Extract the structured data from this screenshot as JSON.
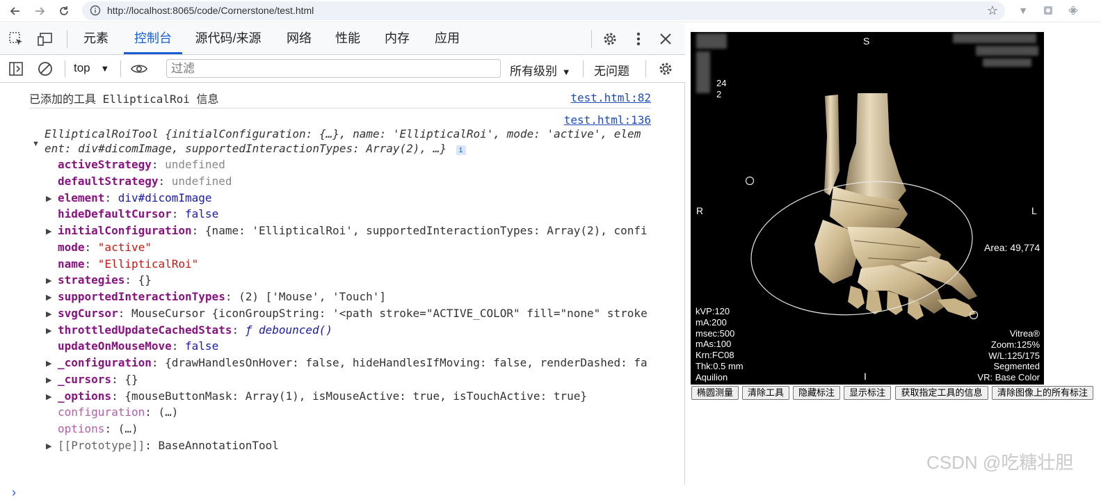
{
  "browser": {
    "url": "http://localhost:8065/code/Cornerstone/test.html"
  },
  "devtools": {
    "tabs": [
      "元素",
      "控制台",
      "源代码/来源",
      "网络",
      "性能",
      "内存",
      "应用"
    ],
    "active_tab": "控制台",
    "context": "top",
    "filter_placeholder": "过滤",
    "levels": "所有级别",
    "issues": "无问题"
  },
  "console": {
    "message1": {
      "text": "已添加的工具 EllipticalRoi 信息",
      "source": "test.html:82"
    },
    "message2": {
      "source": "test.html:136",
      "summary_line1": "EllipticalRoiTool {initialConfiguration: {…}, name: 'EllipticalRoi', mode: 'active', elem",
      "summary_line2": "ent: div#dicomImage, supportedInteractionTypes: Array(2), …}",
      "info_badge": "i",
      "props": [
        {
          "key": "activeStrategy",
          "value": "undefined"
        },
        {
          "key": "defaultStrategy",
          "value": "undefined"
        },
        {
          "key": "element",
          "value": "div#dicomImage"
        },
        {
          "key": "hideDefaultCursor",
          "value": "false"
        },
        {
          "key": "initialConfiguration",
          "value": "{name: 'EllipticalRoi', supportedInteractionTypes: Array(2), confi"
        },
        {
          "key": "mode",
          "value": "\"active\""
        },
        {
          "key": "name",
          "value": "\"EllipticalRoi\""
        },
        {
          "key": "strategies",
          "value": "{}"
        },
        {
          "key": "supportedInteractionTypes",
          "value": "(2) ['Mouse', 'Touch']"
        },
        {
          "key": "svgCursor",
          "value": "MouseCursor {iconGroupString: '<path stroke=\"ACTIVE_COLOR\" fill=\"none\" stroke"
        },
        {
          "key": "throttledUpdateCachedStats",
          "value": "ƒ debounced()"
        },
        {
          "key": "updateOnMouseMove",
          "value": "false"
        },
        {
          "key": "_configuration",
          "value": "{drawHandlesOnHover: false, hideHandlesIfMoving: false, renderDashed: fa"
        },
        {
          "key": "_cursors",
          "value": "{}"
        },
        {
          "key": "_options",
          "value": "{mouseButtonMask: Array(1), isMouseActive: true, isTouchActive: true}"
        },
        {
          "key": "configuration",
          "value": "(…)"
        },
        {
          "key": "options",
          "value": "(…)"
        },
        {
          "key": "[[Prototype]]",
          "value": "BaseAnnotationTool"
        }
      ]
    },
    "prompt": "›"
  },
  "viewer": {
    "top_label": "S",
    "left_label": "R",
    "right_label": "L",
    "bottom_label": "I",
    "partial_text_1": "24",
    "partial_text_2": "2",
    "area_text": "Area: 49,774",
    "bottom_left": [
      "kVP:120",
      "mA:200",
      "msec:500",
      "mAs:100",
      "Krn:FC08",
      "Thk:0.5 mm",
      "Aquilion"
    ],
    "bottom_right": [
      "Vitrea®",
      "Zoom:125%",
      "W/L:125/175",
      "Segmented",
      "VR: Base Color"
    ]
  },
  "page_buttons": [
    "椭圆测量",
    "清除工具",
    "隐藏标注",
    "显示标注",
    "获取指定工具的信息",
    "清除图像上的所有标注"
  ],
  "watermark": "CSDN @吃糖壮胆"
}
